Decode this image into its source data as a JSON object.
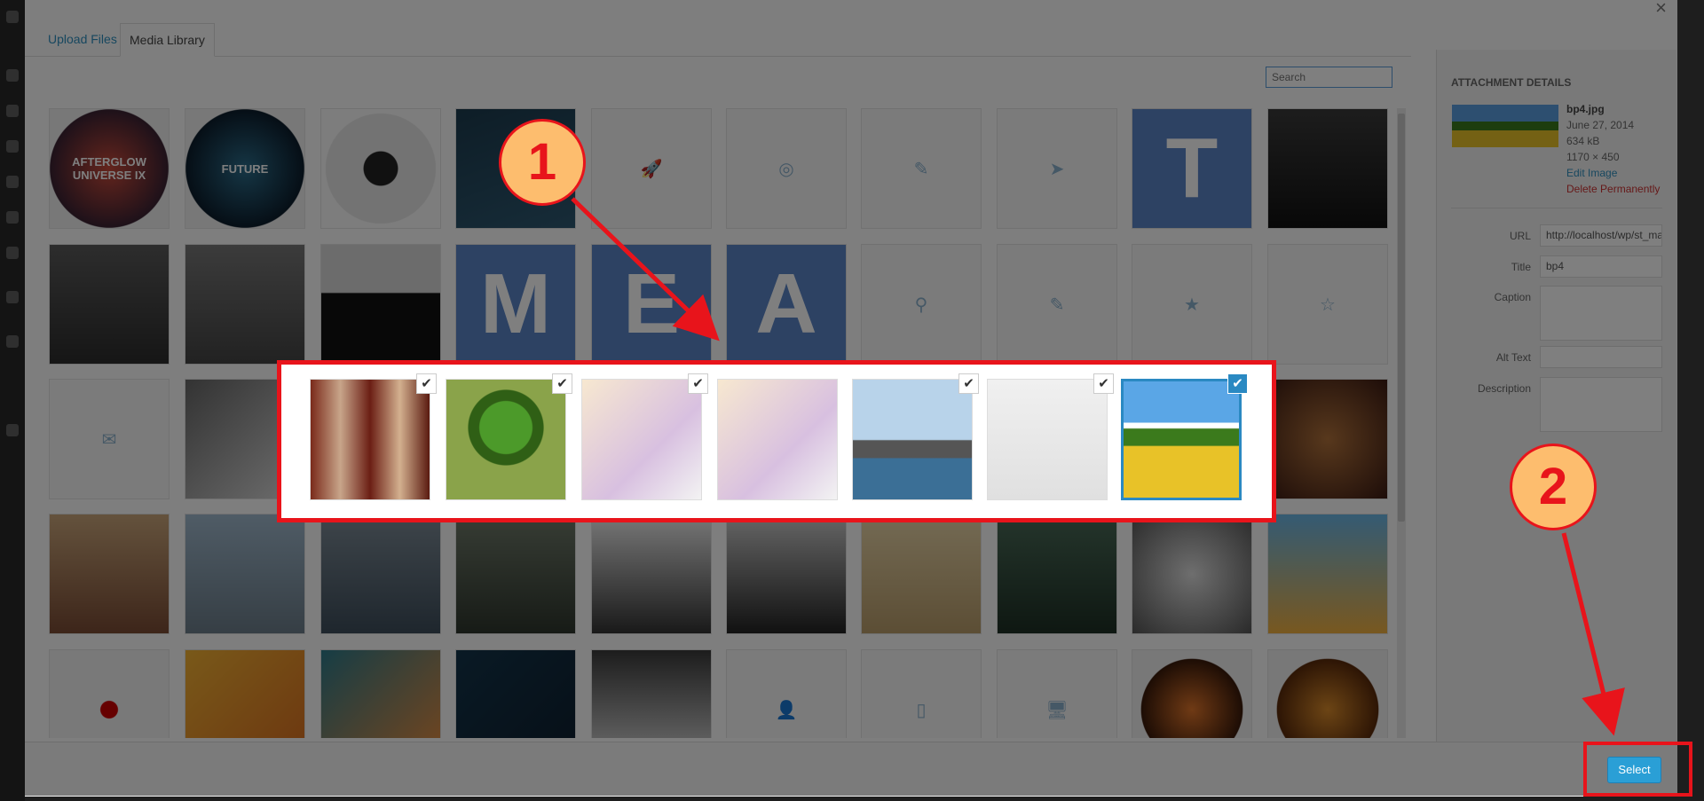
{
  "colors": {
    "accent": "#2a9fd6",
    "annotation": "#e8141b",
    "badge_fill": "#fdbd6e",
    "link": "#2e8fbf",
    "danger": "#cc3333"
  },
  "modal": {
    "close_icon": "close-icon",
    "tabs": [
      {
        "label": "Upload Files"
      },
      {
        "label": "Media Library"
      }
    ],
    "search": {
      "placeholder": "Search",
      "value": ""
    }
  },
  "library": {
    "rows": [
      [
        {
          "kind": "image",
          "label": "AFTERGLOW UNIVERSE IX",
          "fg": "#ffffff",
          "bg": "radial-gradient(circle, #c84a3a, #3b2233 70%, #f0f0f0 71%)"
        },
        {
          "kind": "image",
          "label": "FUTURE",
          "fg": "#ffffff",
          "bg": "radial-gradient(circle, #2b6c8a, #0c1d2c 70%, #f0f0f0 71%)"
        },
        {
          "kind": "image",
          "label": "",
          "bg": "radial-gradient(circle, #222 20%, #e6e6e6 21% 65%, #fafafa 66%)"
        },
        {
          "kind": "image",
          "label": "",
          "bg": "linear-gradient(160deg, #1c3b4e, #2d5871)"
        },
        {
          "kind": "icon",
          "icon": "rocket-icon",
          "glyph": "🚀"
        },
        {
          "kind": "icon",
          "icon": "lifebuoy-icon",
          "glyph": "◎"
        },
        {
          "kind": "icon",
          "icon": "pencil-icon",
          "glyph": "✎"
        },
        {
          "kind": "icon",
          "icon": "paper-plane-icon",
          "glyph": "➤"
        },
        {
          "kind": "image",
          "label": "T",
          "fg": "#ffffff",
          "bg": "#5b85c7"
        },
        {
          "kind": "image",
          "label": "",
          "bg": "linear-gradient(180deg, #3a3a3a, #111)"
        }
      ],
      [
        {
          "kind": "image",
          "label": "",
          "bg": "linear-gradient(180deg, #5a5a5a, #2c2c2c)"
        },
        {
          "kind": "image",
          "label": "",
          "bg": "linear-gradient(180deg, #777, #444)"
        },
        {
          "kind": "image",
          "label": "",
          "bg": "linear-gradient(180deg, #d8d8d8 40%, #111 41%)"
        },
        {
          "kind": "image",
          "label": "M",
          "fg": "#ffffff",
          "bg": "#5b85c7"
        },
        {
          "kind": "image",
          "label": "E",
          "fg": "#ffffff",
          "bg": "#5b85c7"
        },
        {
          "kind": "image",
          "label": "A",
          "fg": "#ffffff",
          "bg": "#5b85c7"
        },
        {
          "kind": "icon",
          "icon": "map-pin-icon",
          "glyph": "⚲"
        },
        {
          "kind": "icon",
          "icon": "edit-icon",
          "glyph": "✎"
        },
        {
          "kind": "icon",
          "icon": "star-icon",
          "glyph": "★"
        },
        {
          "kind": "icon",
          "icon": "star-outline-icon",
          "glyph": "☆"
        }
      ],
      [
        {
          "kind": "icon",
          "icon": "mail-icon",
          "glyph": "✉"
        },
        {
          "kind": "image",
          "label": "",
          "bg": "linear-gradient(135deg, #666, #ddd)"
        },
        {
          "kind": "image",
          "label": "",
          "bg": "linear-gradient(135deg, #888, #ccc)"
        },
        {
          "kind": "image",
          "label": "",
          "bg": "linear-gradient(135deg, #bbb, #eee)"
        },
        {
          "kind": "image",
          "label": "",
          "bg": "linear-gradient(135deg, #bbb, #eee)"
        },
        {
          "kind": "image",
          "label": "",
          "bg": "linear-gradient(135deg, #bbb, #eee)"
        },
        {
          "kind": "image",
          "label": "",
          "bg": "linear-gradient(135deg, #bbb, #eee)"
        },
        {
          "kind": "image",
          "label": "",
          "bg": "linear-gradient(135deg, #bbb, #eee)"
        },
        {
          "kind": "image",
          "label": "",
          "bg": "linear-gradient(135deg, #bbb, #eee)"
        },
        {
          "kind": "image",
          "label": "",
          "bg": "radial-gradient(circle, #b0713a, #3b1a12)"
        }
      ],
      [
        {
          "kind": "image",
          "label": "",
          "bg": "linear-gradient(180deg, #c9a57a, #7a4b34)"
        },
        {
          "kind": "image",
          "label": "",
          "bg": "linear-gradient(180deg, #9fb8cc, #6c7d8a)"
        },
        {
          "kind": "image",
          "label": "",
          "bg": "linear-gradient(180deg, #7d8b96, #3d4d5b)"
        },
        {
          "kind": "image",
          "label": "",
          "bg": "linear-gradient(180deg, #6f7a6a, #2e362d)"
        },
        {
          "kind": "image",
          "label": "",
          "bg": "linear-gradient(180deg, #f0f0f0, #333)"
        },
        {
          "kind": "image",
          "label": "",
          "bg": "linear-gradient(180deg, #ccc, #222)"
        },
        {
          "kind": "image",
          "label": "",
          "bg": "linear-gradient(180deg, #e8d5a8, #b89c6a)"
        },
        {
          "kind": "image",
          "label": "",
          "bg": "linear-gradient(180deg, #4a6b58, #1d2f24)"
        },
        {
          "kind": "image",
          "label": "",
          "bg": "radial-gradient(circle, #ddd, #555)"
        },
        {
          "kind": "image",
          "label": "",
          "bg": "linear-gradient(180deg, #69b6e6, #f0b040)"
        }
      ],
      [
        {
          "kind": "image",
          "label": "",
          "bg": "radial-gradient(circle, #c00 10%, #f3f3f3 11%)"
        },
        {
          "kind": "image",
          "label": "",
          "bg": "linear-gradient(135deg, #f2b233, #d96b1f)"
        },
        {
          "kind": "image",
          "label": "",
          "bg": "linear-gradient(135deg, #2d7a8a, #ef8c3a)"
        },
        {
          "kind": "image",
          "label": "",
          "bg": "linear-gradient(135deg, #13344a, #0d1e2e)"
        },
        {
          "kind": "image",
          "label": "",
          "bg": "linear-gradient(180deg, #3a3a3a, #e6e6e6)"
        },
        {
          "kind": "icon",
          "icon": "user-icon",
          "glyph": "👤"
        },
        {
          "kind": "icon",
          "icon": "mobile-icon",
          "glyph": "▯"
        },
        {
          "kind": "icon",
          "icon": "desktop-icon",
          "glyph": "🖥"
        },
        {
          "kind": "image",
          "label": "",
          "bg": "radial-gradient(circle, #e0752a, #3a1a0a 60%, #f0f0f0 61%)"
        },
        {
          "kind": "image",
          "label": "",
          "bg": "radial-gradient(circle, #d98a2a, #5a2a0a 60%, #f0f0f0 61%)"
        }
      ]
    ],
    "selection_strip": [
      {
        "name": "wood-frame",
        "checked": true,
        "active": false,
        "bg": "linear-gradient(90deg, #7a2a1a, #c8a58a, #6b1e14, #d3b08f, #5a1a10)"
      },
      {
        "name": "tree-globe",
        "checked": true,
        "active": false,
        "bg": "radial-gradient(circle at 50% 40%, #4c9a2a 28%, #2f5f15 29% 40%, #8aa34a 41%)"
      },
      {
        "name": "autumn-leaf",
        "checked": true,
        "active": false,
        "bg": "linear-gradient(135deg, #f7e8d0, #d8c0e0 60%, #f3f3f3)"
      },
      {
        "name": "autumn-leaf-2",
        "checked": false,
        "active": false,
        "bg": "linear-gradient(135deg, #f7e8d0, #d8c0e0 60%, #f3f3f3)"
      },
      {
        "name": "city-skyline",
        "checked": true,
        "active": false,
        "bg": "linear-gradient(180deg, #b8d3ea 50%, #555 51% 65%, #3b6f96 66%)"
      },
      {
        "name": "new-year-2014",
        "checked": true,
        "active": false,
        "bg": "linear-gradient(180deg, #f0f0f0, #e0e0e0)"
      },
      {
        "name": "sunflowers",
        "checked": true,
        "active": true,
        "bg": "linear-gradient(180deg, #5aa6e6 0 35%, #fff 36% 40%, #3b7a1c 41% 55%, #e8c228 56%)"
      }
    ]
  },
  "details": {
    "heading": "ATTACHMENT DETAILS",
    "filename": "bp4.jpg",
    "date": "June 27, 2014",
    "size": "634 kB",
    "dimensions": "1170 × 450",
    "edit_link": "Edit Image",
    "delete_link": "Delete Permanently",
    "fields": [
      {
        "label": "URL",
        "value": "http://localhost/wp/st_maril"
      },
      {
        "label": "Title",
        "value": "bp4"
      },
      {
        "label": "Caption",
        "value": ""
      },
      {
        "label": "Alt Text",
        "value": ""
      },
      {
        "label": "Description",
        "value": ""
      }
    ]
  },
  "footer": {
    "select_label": "Select"
  },
  "annotations": [
    {
      "label": "1"
    },
    {
      "label": "2"
    }
  ]
}
